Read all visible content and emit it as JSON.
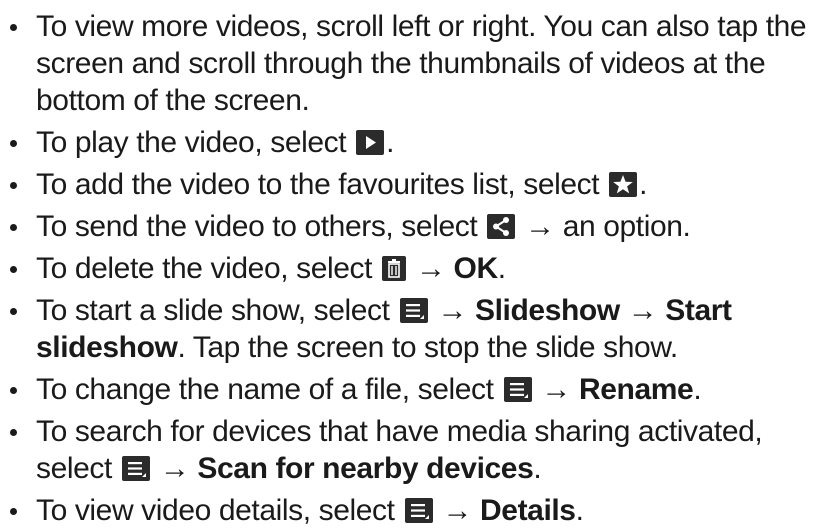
{
  "items": [
    {
      "t1": "To view more videos, scroll left or right. You can also tap the screen and scroll through the thumbnails of videos at the bottom of the screen."
    },
    {
      "t1": "To play the video, select",
      "t2": "."
    },
    {
      "t1": "To add the video to the favourites list, select",
      "t2": "."
    },
    {
      "t1": "To send the video to others, select",
      "t2": " → an option."
    },
    {
      "t1": "To delete the video, select",
      "arrow": " → ",
      "b1": "OK",
      "t2": "."
    },
    {
      "t1": "To start a slide show, select",
      "arrow": " → ",
      "b1": "Slideshow",
      "arrow2": " → ",
      "b2": "Start slideshow",
      "t2": ". Tap the screen to stop the slide show."
    },
    {
      "t1": "To change the name of a file, select",
      "arrow": " → ",
      "b1": "Rename",
      "t2": "."
    },
    {
      "t1": "To search for devices that have media sharing activated, select",
      "arrow": " → ",
      "b1": "Scan for nearby devices",
      "t2": "."
    },
    {
      "t1": "To view video details, select",
      "arrow": " → ",
      "b1": "Details",
      "t2": "."
    }
  ]
}
